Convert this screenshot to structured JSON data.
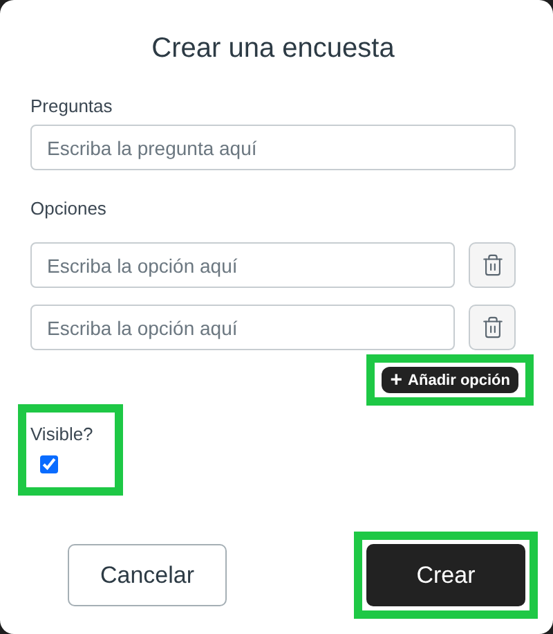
{
  "dialog": {
    "title": "Crear una encuesta"
  },
  "question": {
    "label": "Preguntas",
    "placeholder": "Escriba la pregunta aquí"
  },
  "options": {
    "label": "Opciones",
    "items": [
      {
        "placeholder": "Escriba la opción aquí"
      },
      {
        "placeholder": "Escriba la opción aquí"
      }
    ],
    "add_button": {
      "icon": "+",
      "label": "Añadir opción",
      "highlighted": true
    }
  },
  "visible": {
    "label": "Visible?",
    "checked": true,
    "highlighted": true
  },
  "buttons": [
    {
      "label": "Cancelar",
      "kind": "secondary",
      "highlighted": false
    },
    {
      "label": "Crear",
      "kind": "primary",
      "highlighted": true
    }
  ]
}
